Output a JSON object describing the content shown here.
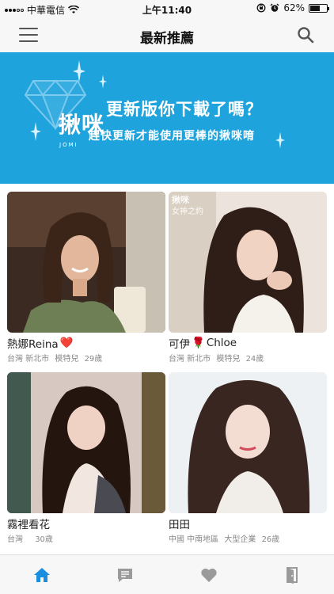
{
  "status_bar": {
    "carrier": "中華電信",
    "time": "上午11:40",
    "battery_percent": "62%",
    "battery_level": 0.62
  },
  "nav": {
    "title": "最新推薦"
  },
  "banner": {
    "logo": "揪咪",
    "logo_sub": "JOMI",
    "title": "更新版你下載了嗎？",
    "subtitle": "趕快更新才能使用更棒的揪咪唷"
  },
  "profiles": [
    {
      "name": "熱娜Reina",
      "emoji": "❤️",
      "location": "台灣 新北市",
      "occupation": "模特兒",
      "age": "29歲"
    },
    {
      "name_prefix": "可伊",
      "emoji": "🌹",
      "name": "Chloe",
      "location": "台灣 新北市",
      "occupation": "模特兒",
      "age": "24歲",
      "photo_watermark": "揪咪",
      "photo_caption": "女神之約"
    },
    {
      "name": "霧裡看花",
      "location": "台灣",
      "age": "30歲"
    },
    {
      "name": "田田",
      "location": "中國 中南地區",
      "occupation": "大型企業",
      "age": "26歲"
    }
  ],
  "colors": {
    "banner": "#1fa3dc",
    "tab_active": "#1a8fe0",
    "tab_inactive": "#9a9a9a",
    "heart": "#e11d2e"
  },
  "tabs": [
    {
      "icon": "home-icon",
      "active": true
    },
    {
      "icon": "chat-icon",
      "active": false
    },
    {
      "icon": "heart-icon",
      "active": false
    },
    {
      "icon": "exit-door-icon",
      "active": false
    }
  ]
}
